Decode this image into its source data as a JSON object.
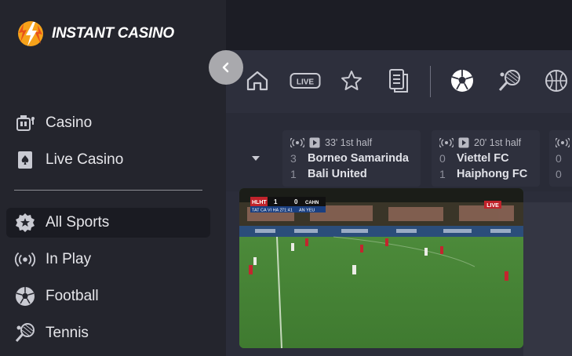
{
  "brand": {
    "name": "INSTANT CASINO"
  },
  "sidebar": {
    "items": [
      {
        "label": "Casino",
        "icon": "casino-icon"
      },
      {
        "label": "Live Casino",
        "icon": "cards-icon"
      },
      {
        "label": "All Sports",
        "icon": "star-badge-icon",
        "active": true
      },
      {
        "label": "In Play",
        "icon": "broadcast-icon"
      },
      {
        "label": "Football",
        "icon": "football-icon"
      },
      {
        "label": "Tennis",
        "icon": "tennis-icon"
      }
    ]
  },
  "sports_bar": [
    "home-icon",
    "live-icon",
    "favorites-star-icon",
    "betslip-icon",
    "football-icon",
    "tennis-icon",
    "basketball-icon"
  ],
  "live_label": "LIVE",
  "matches": [
    {
      "time": "33' 1st half",
      "home": "Borneo Samarinda",
      "home_score": "3",
      "away": "Bali United",
      "away_score": "1"
    },
    {
      "time": "20' 1st half",
      "home": "Viettel FC",
      "home_score": "0",
      "away": "Haiphong FC",
      "away_score": "1"
    },
    {
      "time": "",
      "home": "",
      "home_score": "0",
      "away": "",
      "away_score": "0"
    }
  ],
  "video": {
    "live_badge": "LIVE",
    "score_home_abbr": "HLHT",
    "score_home": "1",
    "score_away": "0",
    "score_away_abbr": "CAHN",
    "clock": "71:41",
    "score_caption": "TAT CA VI HA 2",
    "score_caption_away": "AN YEU"
  },
  "colors": {
    "accent": "#f6a21a",
    "active_bg": "#1a1b22",
    "sidebar_bg": "#24252d"
  }
}
